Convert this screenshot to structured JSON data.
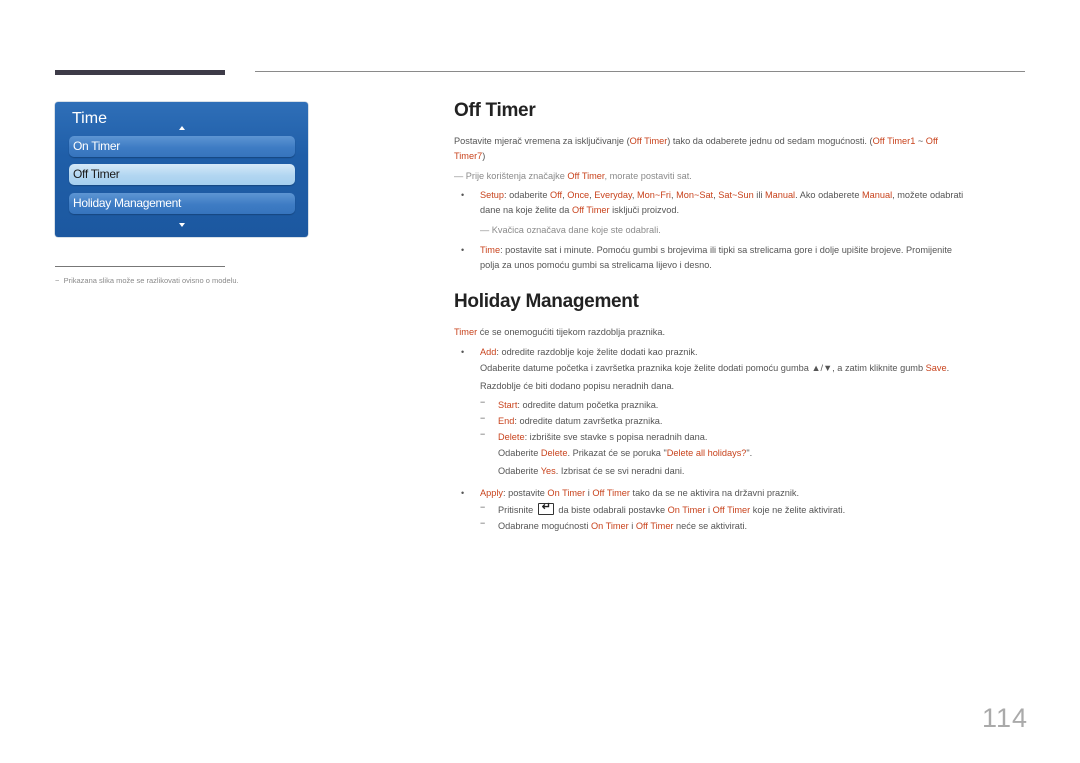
{
  "sidebar_menu": {
    "title": "Time",
    "items": [
      {
        "label": "On Timer",
        "selected": false
      },
      {
        "label": "Off Timer",
        "selected": true
      },
      {
        "label": "Holiday Management",
        "selected": false
      }
    ],
    "footnote": "Prikazana slika može se razlikovati ovisno o modelu."
  },
  "off_timer": {
    "heading": "Off Timer",
    "intro": {
      "a": "Postavite mjerač vremena za isključivanje (",
      "b": "Off Timer",
      "c": ") tako da odaberete jednu od sedam mogućnosti. (",
      "d": "Off Timer1",
      "e": " ~ ",
      "f": "Off",
      "g": "Timer7",
      "h": ")"
    },
    "note1": {
      "a": "Prije korištenja značajke ",
      "b": "Off Timer",
      "c": ", morate postaviti sat."
    },
    "setup": {
      "a": "Setup",
      "b": ": odaberite ",
      "c": "Off",
      "d": ", ",
      "e": "Once",
      "f": "Everyday",
      "g": "Mon~Fri",
      "h": "Mon~Sat",
      "i": "Sat~Sun",
      "j": " ili ",
      "k": "Manual",
      "l": ". Ako odaberete ",
      "m": "Manual",
      "n": ", možete odabrati",
      "line2a": "dane na koje želite da ",
      "line2b": "Off Timer",
      "line2c": " isključi proizvod."
    },
    "note2": "Kvačica označava dane koje ste odabrali.",
    "time": {
      "a": "Time",
      "b": ": postavite sat i minute. Pomoću gumbi s brojevima ili tipki sa strelicama gore i dolje upišite brojeve. Promijenite",
      "line2": "polja za unos pomoću gumbi sa strelicama lijevo i desno."
    }
  },
  "holiday": {
    "heading": "Holiday Management",
    "intro": {
      "a": "Timer",
      "b": " će se onemogućiti tijekom razdoblja praznika."
    },
    "add": {
      "a": "Add",
      "b": ": odredite razdoblje koje želite dodati kao praznik."
    },
    "add_desc": {
      "a": "Odaberite datume početka i završetka praznika koje želite dodati pomoću gumba ▲/▼, a zatim kliknite gumb ",
      "b": "Save",
      "c": "."
    },
    "add_desc2": "Razdoblje će biti dodano popisu neradnih dana.",
    "start": {
      "a": "Start",
      "b": ": odredite datum početka praznika."
    },
    "end": {
      "a": "End",
      "b": ": odredite datum završetka praznika."
    },
    "delete": {
      "a": "Delete",
      "b": ": izbrišite sve stavke s popisa neradnih dana."
    },
    "delete_desc": {
      "a": "Odaberite ",
      "b": "Delete",
      "c": ". Prikazat će se poruka \"",
      "d": "Delete all holidays?",
      "e": "\"."
    },
    "delete_desc2": {
      "a": "Odaberite ",
      "b": "Yes",
      "c": ". Izbrisat će se svi neradni dani."
    },
    "apply": {
      "a": "Apply",
      "b": ": postavite ",
      "c": "On Timer",
      "d": " i ",
      "e": "Off Timer",
      "f": " tako da se ne aktivira na državni praznik."
    },
    "apply1": {
      "a": "Pritisnite",
      "b": " da biste odabrali postavke ",
      "c": "On Timer",
      "d": " i ",
      "e": "Off Timer",
      "f": " koje ne želite aktivirati."
    },
    "apply2": {
      "a": "Odabrane mogućnosti ",
      "b": "On Timer",
      "c": " i ",
      "d": "Off Timer",
      "e": " neće se aktivirati."
    }
  },
  "symbols": {
    "bullet": "•",
    "dash": "−",
    "note_dash": "—"
  },
  "page_number": "114",
  "colors": {
    "accent": "#c8431d",
    "menu_blue": "#1f5ea8"
  }
}
